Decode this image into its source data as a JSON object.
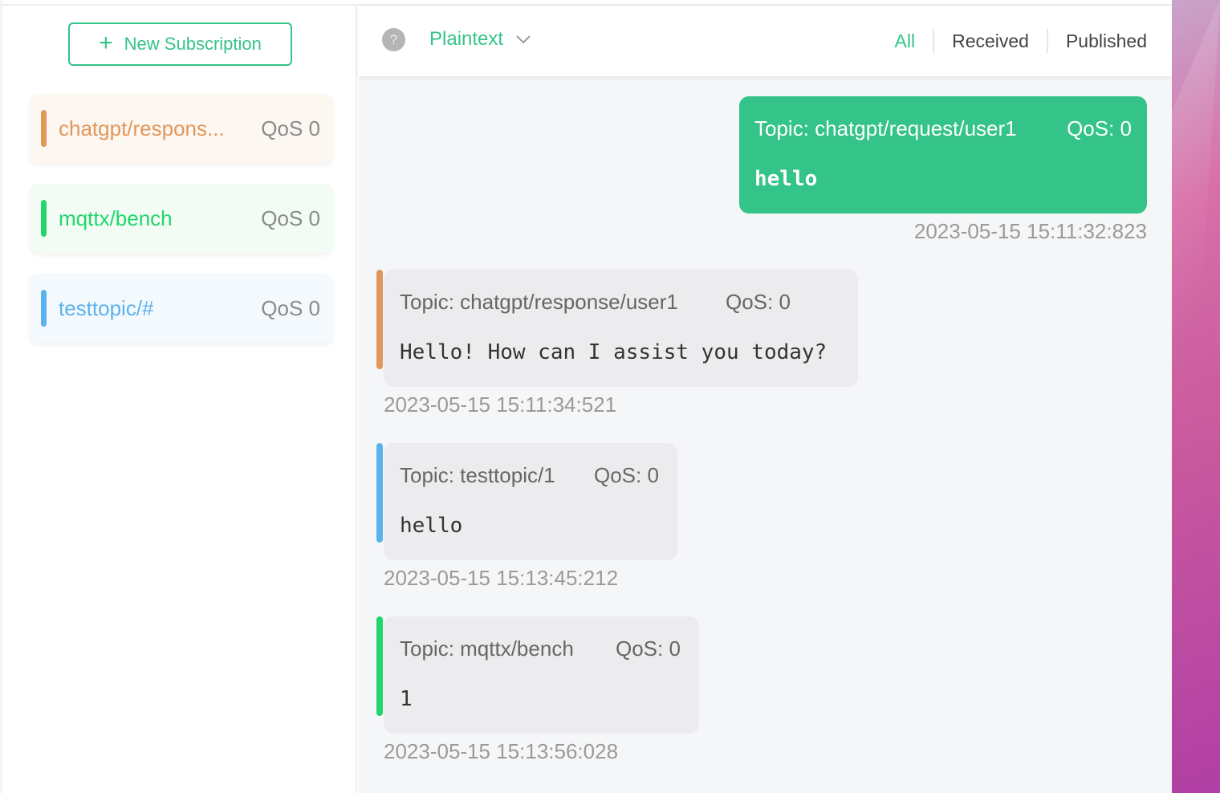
{
  "sidebar": {
    "new_subscription_label": "New Subscription",
    "plus_glyph": "+",
    "subscriptions": [
      {
        "topic": "chatgpt/respons...",
        "qos": "QoS 0",
        "color": "#e0975a"
      },
      {
        "topic": "mqttx/bench",
        "qos": "QoS 0",
        "color": "#22d66b"
      },
      {
        "topic": "testtopic/#",
        "qos": "QoS 0",
        "color": "#5cb3ec"
      }
    ]
  },
  "toolbar": {
    "help_glyph": "?",
    "payload_format": "Plaintext",
    "filters": [
      "All",
      "Received",
      "Published"
    ],
    "active_filter": "All"
  },
  "messages": [
    {
      "direction": "published",
      "topic": "Topic: chatgpt/request/user1",
      "qos": "QoS: 0",
      "payload": "hello",
      "timestamp": "2023-05-15 15:11:32:823"
    },
    {
      "direction": "received",
      "topic": "Topic: chatgpt/response/user1",
      "qos": "QoS: 0",
      "payload": "Hello! How can I assist you today?",
      "timestamp": "2023-05-15 15:11:34:521",
      "color": "#e0975a"
    },
    {
      "direction": "received",
      "topic": "Topic: testtopic/1",
      "qos": "QoS: 0",
      "payload": "hello",
      "timestamp": "2023-05-15 15:13:45:212",
      "color": "#5cb3ec"
    },
    {
      "direction": "received",
      "topic": "Topic: mqttx/bench",
      "qos": "QoS: 0",
      "payload": "1",
      "timestamp": "2023-05-15 15:13:56:028",
      "color": "#22d66b"
    }
  ],
  "theme": {
    "accent": "#34c388"
  }
}
